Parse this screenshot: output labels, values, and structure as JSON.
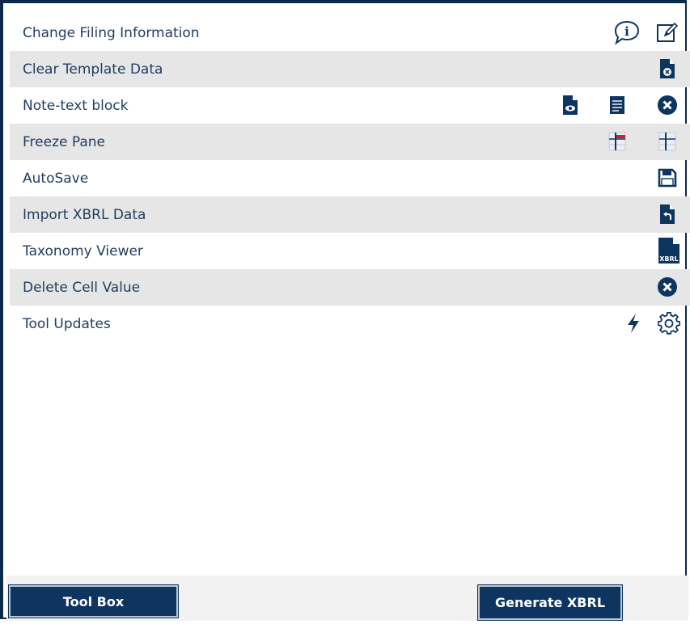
{
  "rows": [
    {
      "label": "Change Filing Information",
      "icons": [
        "info-bubble-icon",
        "edit-note-icon"
      ]
    },
    {
      "label": "Clear Template Data",
      "icons": [
        "clear-document-icon"
      ]
    },
    {
      "label": "Note-text block",
      "icons": [
        "preview-document-icon",
        "text-block-icon",
        "close-circle-icon"
      ]
    },
    {
      "label": "Freeze Pane",
      "icons": [
        "freeze-pane-on-icon",
        "freeze-pane-off-icon"
      ]
    },
    {
      "label": "AutoSave",
      "icons": [
        "save-icon"
      ]
    },
    {
      "label": "Import XBRL Data",
      "icons": [
        "import-document-icon"
      ]
    },
    {
      "label": "Taxonomy Viewer",
      "icons": [
        "xbrl-document-icon"
      ]
    },
    {
      "label": "Delete Cell Value",
      "icons": [
        "close-circle-icon"
      ]
    },
    {
      "label": "Tool Updates",
      "icons": [
        "lightning-icon",
        "gear-icon"
      ]
    }
  ],
  "xbrl_icon_text": "XBRL",
  "footer": {
    "toolbox_label": "Tool Box",
    "generate_label": "Generate XBRL"
  },
  "colors": {
    "text": "#1f3c5f",
    "icon": "#0d3560",
    "button_bg": "#0d3560",
    "row_alt": "#e6e6e6",
    "accent_red": "#d62020"
  }
}
